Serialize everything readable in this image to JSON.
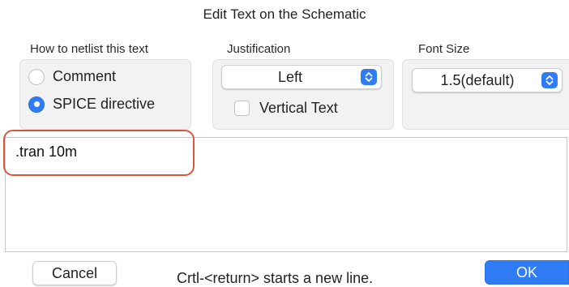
{
  "dialog": {
    "title": "Edit Text on the Schematic"
  },
  "netlist": {
    "label": "How to netlist this text",
    "options": [
      {
        "label": "Comment",
        "selected": false
      },
      {
        "label": "SPICE directive",
        "selected": true
      }
    ]
  },
  "justification": {
    "label": "Justification",
    "selected": "Left",
    "vertical_text_label": "Vertical Text",
    "vertical_text_checked": false
  },
  "font_size": {
    "label": "Font Size",
    "selected": "1.5(default)"
  },
  "editor": {
    "text": ".tran 10m"
  },
  "footer": {
    "cancel_label": "Cancel",
    "hint": "Crtl-<return> starts a new line.",
    "ok_label": "OK"
  },
  "colors": {
    "accent": "#2f7cf6",
    "highlight": "#d9573f"
  }
}
